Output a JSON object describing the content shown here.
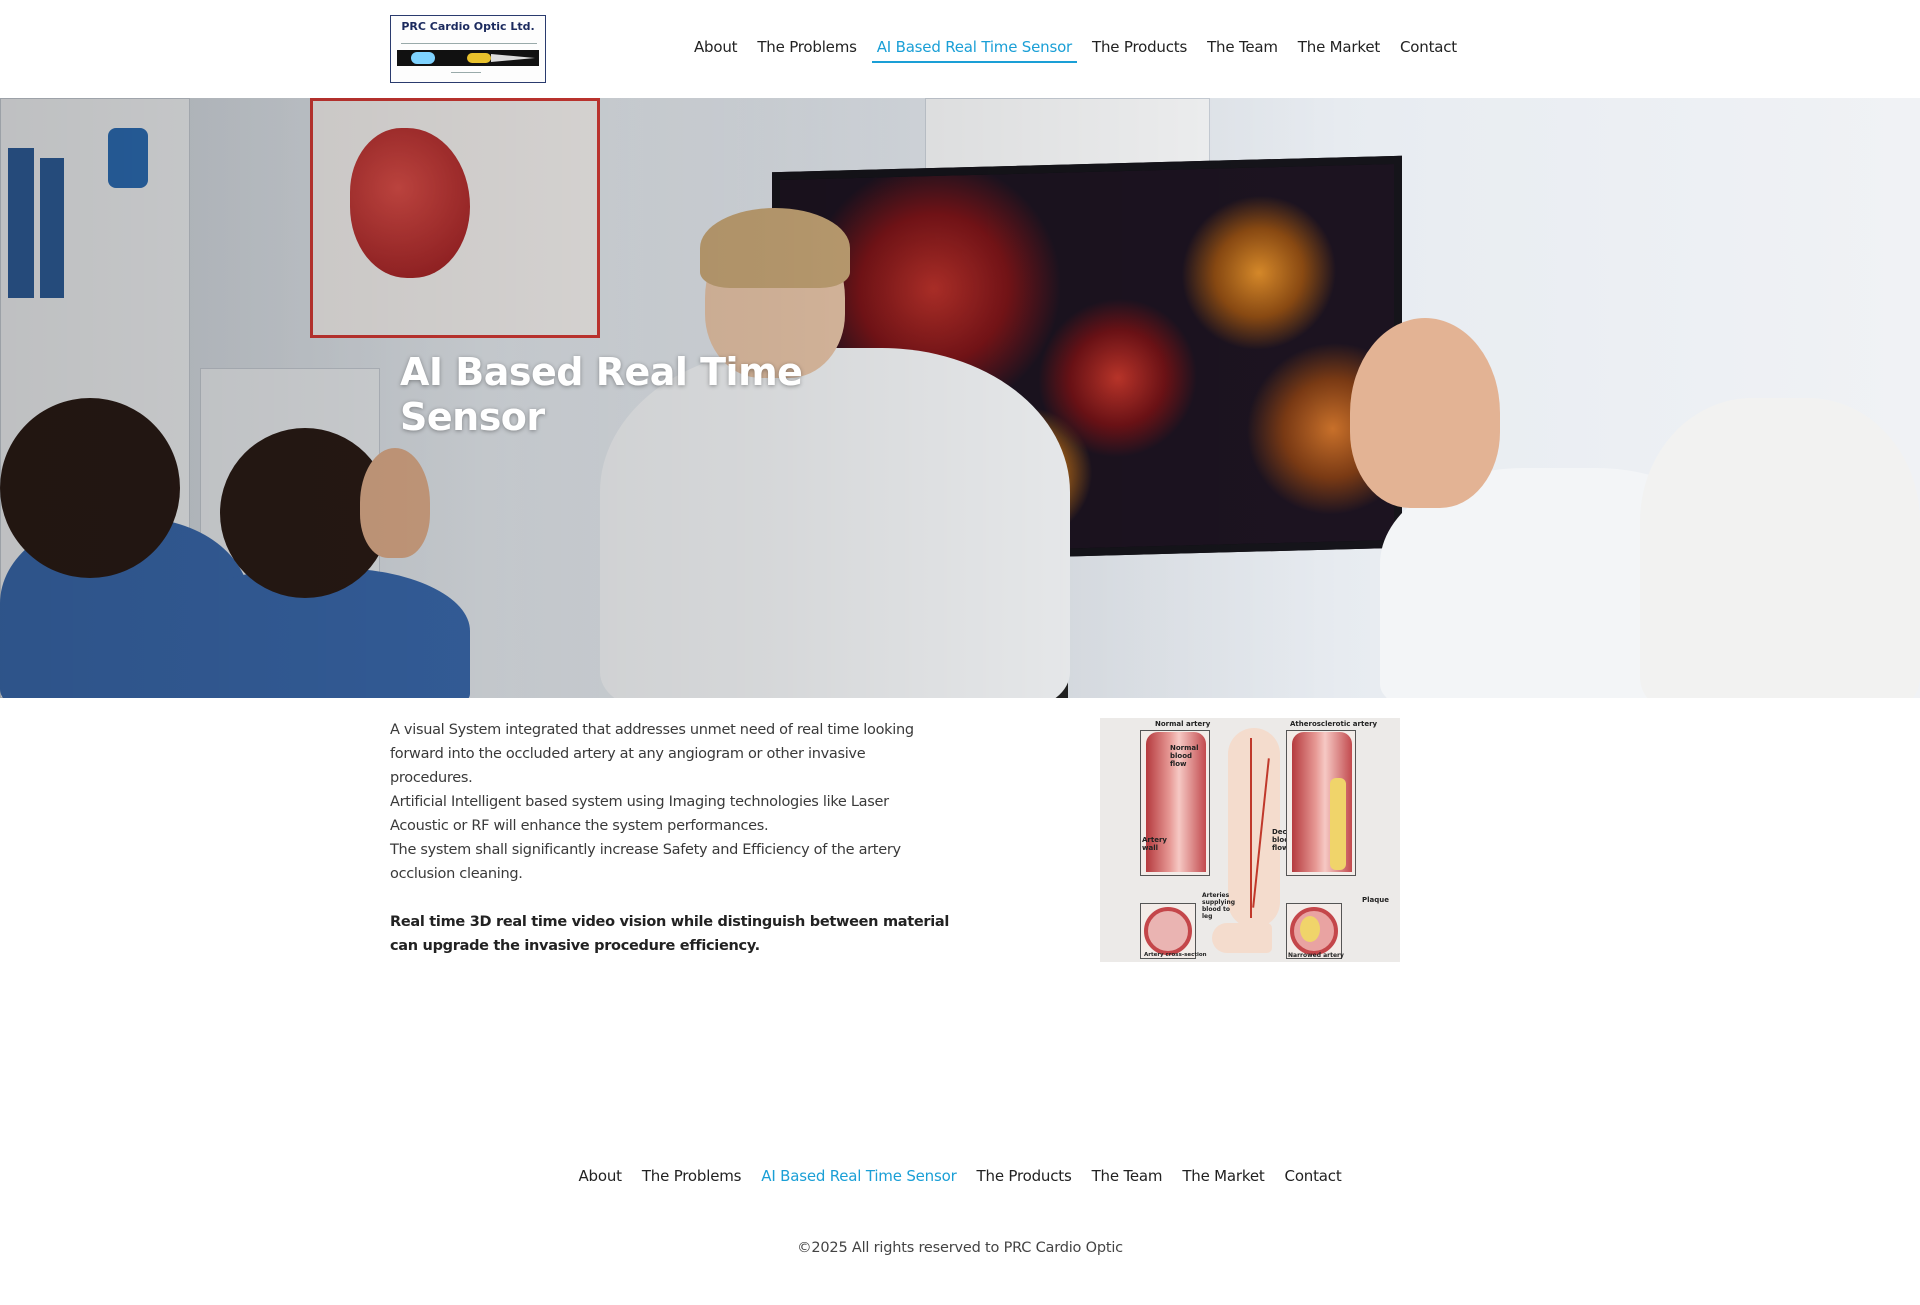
{
  "logo": {
    "title": "PRC Cardio Optic Ltd."
  },
  "nav": {
    "items": [
      {
        "label": "About",
        "active": false
      },
      {
        "label": "The Problems",
        "active": false
      },
      {
        "label": "AI Based Real Time Sensor",
        "active": true
      },
      {
        "label": "The Products",
        "active": false
      },
      {
        "label": "The Team",
        "active": false
      },
      {
        "label": "The Market",
        "active": false
      },
      {
        "label": "Contact",
        "active": false
      }
    ]
  },
  "hero": {
    "title": "AI Based Real Time Sensor"
  },
  "content": {
    "paragraph1": "A visual System integrated that addresses unmet need of real time looking forward into the occluded artery at any angiogram or other invasive procedures.",
    "paragraph2": "Artificial Intelligent based system using Imaging technologies like Laser Acoustic or RF will enhance the system performances.",
    "paragraph3": "The system shall significantly increase Safety and Efficiency of the artery occlusion cleaning.",
    "highlight": "Real time 3D real time video vision while distinguish between material can upgrade the invasive procedure efficiency."
  },
  "figure": {
    "labels": {
      "normal_artery": "Normal artery",
      "atherosclerotic_artery": "Atherosclerotic artery",
      "normal_blood_flow": "Normal blood flow",
      "artery_wall": "Artery wall",
      "decreased_blood_flow": "Decreased blood flow",
      "arteries_supplying": "Arteries supplying blood to leg",
      "plaque": "Plaque",
      "artery_cross_section": "Artery cross-section",
      "narrowed_artery": "Narrowed artery"
    }
  },
  "footer": {
    "nav": [
      {
        "label": "About",
        "active": false
      },
      {
        "label": "The Problems",
        "active": false
      },
      {
        "label": "AI Based Real Time Sensor",
        "active": true
      },
      {
        "label": "The Products",
        "active": false
      },
      {
        "label": "The Team",
        "active": false
      },
      {
        "label": "The Market",
        "active": false
      },
      {
        "label": "Contact",
        "active": false
      }
    ],
    "copyright": "©2025 All rights reserved to PRC Cardio Optic"
  },
  "colors": {
    "accent": "#1a9fd6",
    "text": "#3a3a3a"
  }
}
